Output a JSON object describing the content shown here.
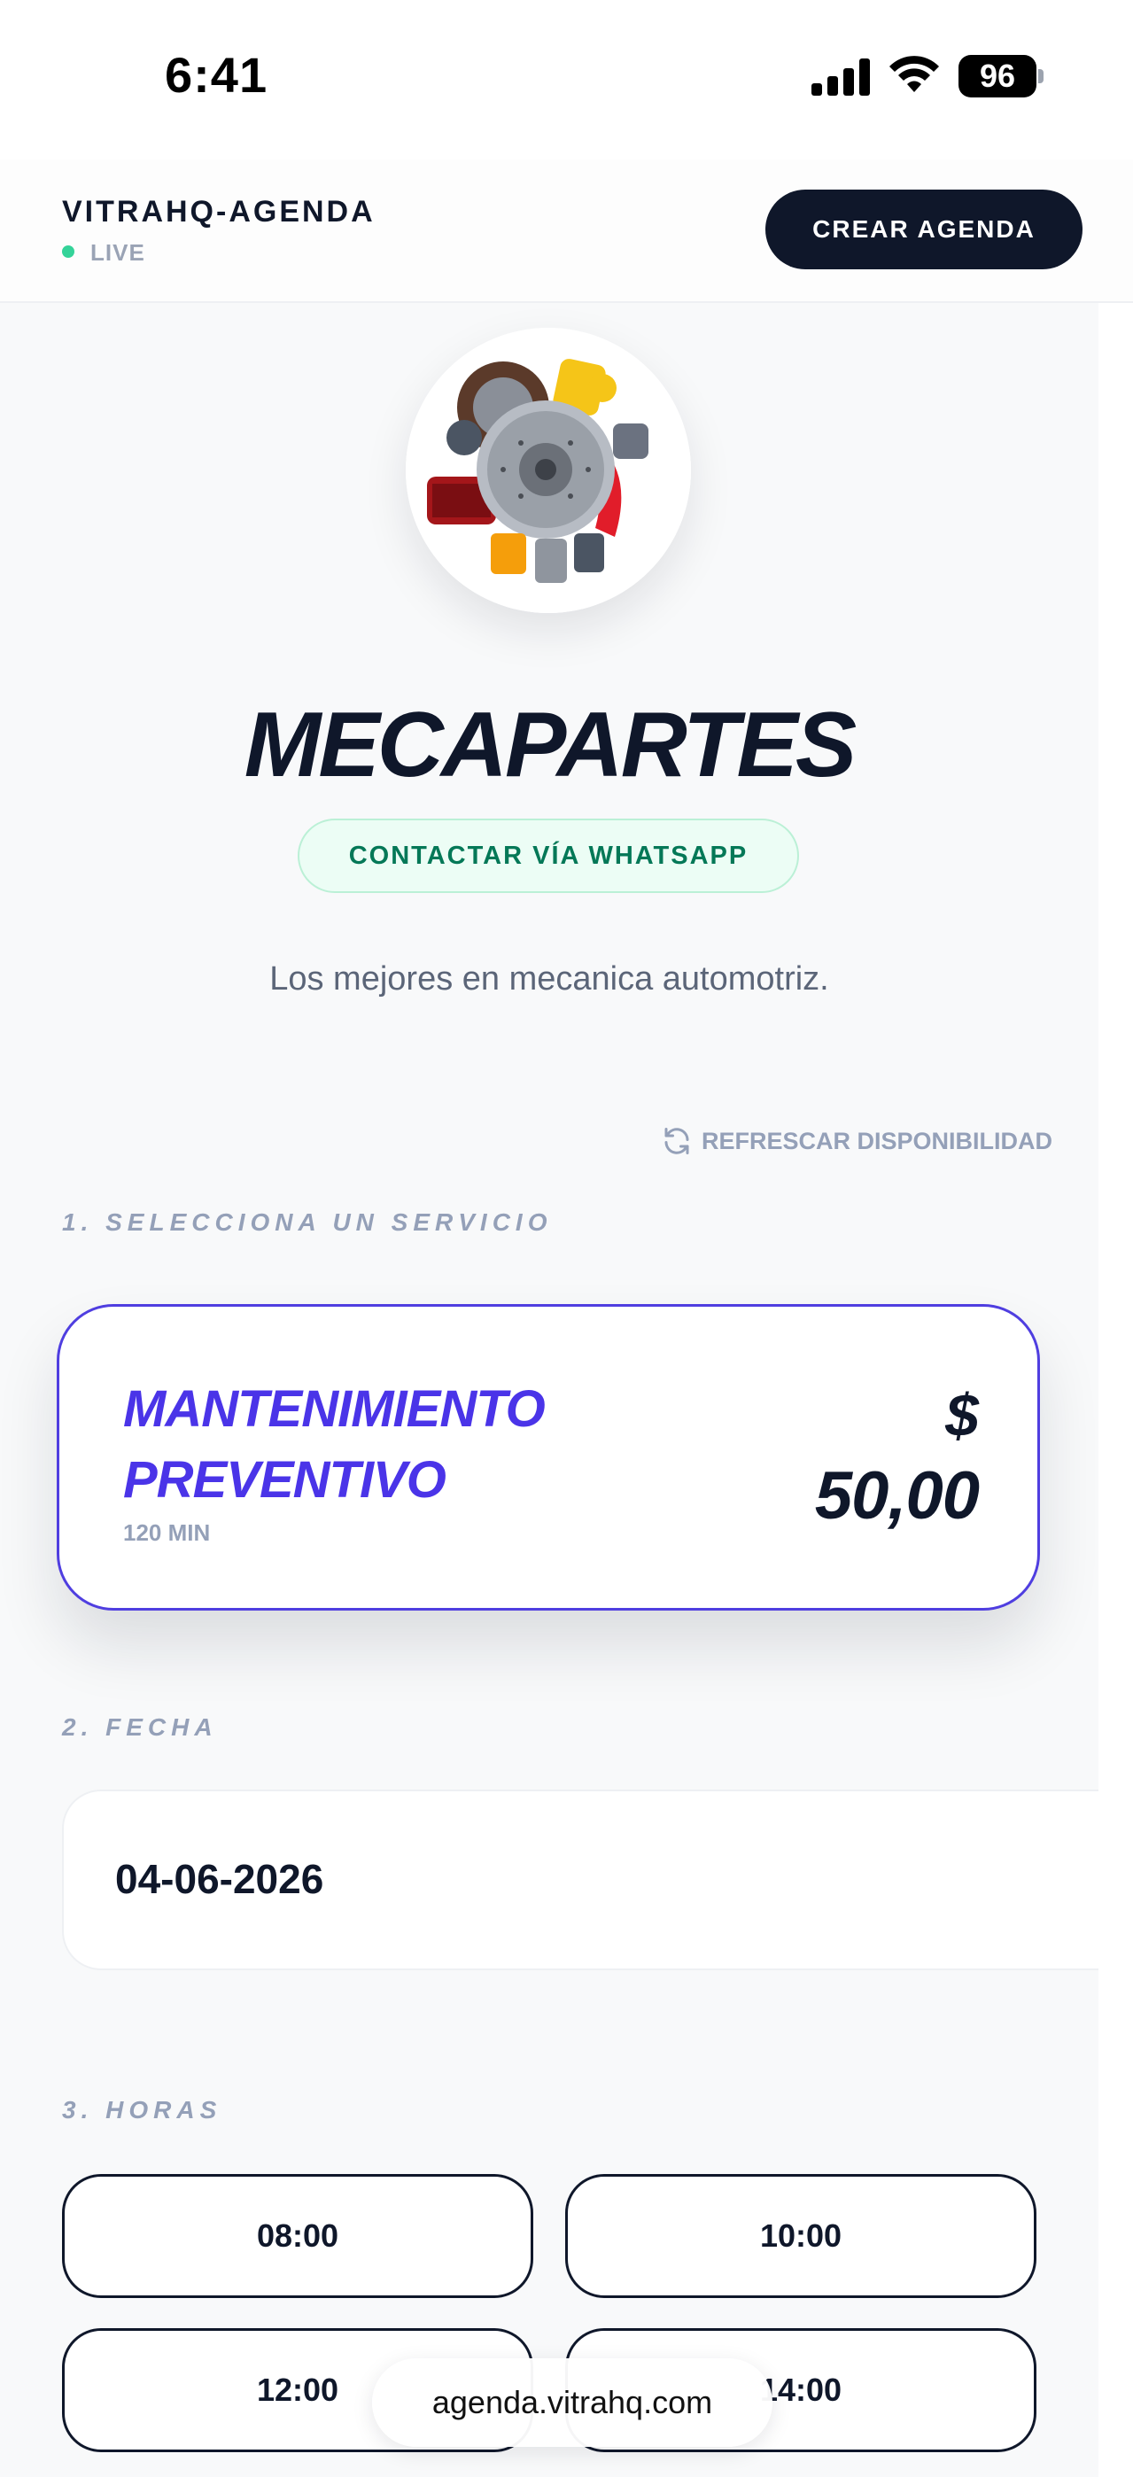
{
  "status_bar": {
    "time": "6:41",
    "battery_level": "96",
    "icons": [
      "signal-icon",
      "wifi-icon",
      "battery-icon"
    ]
  },
  "header": {
    "brand": "VITRAHQ-AGENDA",
    "live_label": "LIVE",
    "create_button": "CREAR AGENDA"
  },
  "business": {
    "logo": "auto-parts-logo",
    "name": "MECAPARTES",
    "whatsapp_button": "CONTACTAR VÍA WHATSAPP",
    "tagline": "Los mejores en mecanica automotriz."
  },
  "refresh": {
    "label": "REFRESCAR DISPONIBILIDAD",
    "icon": "refresh-icon"
  },
  "steps": {
    "service": "1. SELECCIONA UN SERVICIO",
    "date": "2. FECHA",
    "hours": "3. HORAS"
  },
  "service": {
    "name_line1": "MANTENIMIENTO",
    "name_line2": "PREVENTIVO",
    "duration": "120 MIN",
    "currency": "$",
    "price": "50,00"
  },
  "date": {
    "value": "04-06-2026"
  },
  "time_slots": [
    "08:00",
    "10:00",
    "12:00",
    "14:00"
  ],
  "visible_slot_labels": {
    "slot4_partial": "4:00"
  },
  "browser": {
    "url": "agenda.vitrahq.com"
  },
  "colors": {
    "primary": "#0f172a",
    "accent": "#4a34e8",
    "whatsapp_green": "#047857",
    "live_dot": "#34d399",
    "muted": "#94a0b8"
  }
}
